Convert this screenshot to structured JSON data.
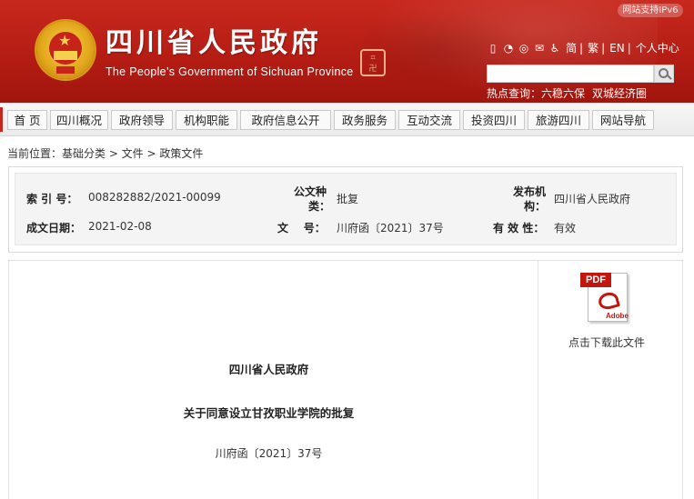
{
  "header": {
    "site_title": "四川省人民政府",
    "site_subtitle": "The People’s Government of Sichuan Province",
    "ipv6_badge": "网站支持IPv6",
    "languages": [
      "简",
      "繁",
      "EN",
      "个人中心"
    ],
    "search_placeholder": "",
    "hot_label": "热点查询：",
    "hot_items": [
      "六稳六保",
      "双城经济圈"
    ],
    "icons": [
      "mobile-icon",
      "weibo-icon",
      "wechat-icon",
      "message-icon",
      "accessibility-icon"
    ]
  },
  "nav": {
    "items": [
      "首 页",
      "四川概况",
      "政府领导",
      "机构职能",
      "政府信息公开",
      "政务服务",
      "互动交流",
      "投资四川",
      "旅游四川",
      "网站导航"
    ]
  },
  "breadcrumb": "当前位置：基础分类 > 文件 > 政策文件",
  "info": {
    "index_label": "索 引 号：",
    "index_value": "008282882/2021-00099",
    "category_label_1": "公文种",
    "category_label_2": "类：",
    "category_value": "批复",
    "issuer_label_1": "发布机",
    "issuer_label_2": "构：",
    "issuer_value": "四川省人民政府",
    "date_label": "成文日期：",
    "date_value": "2021-02-08",
    "docno_label": "文    号：",
    "docno_value": "川府函〔2021〕37号",
    "valid_label": "有 效 性：",
    "valid_value": "有效"
  },
  "download": {
    "pdf_tag": "PDF",
    "adobe": "Adobe",
    "label": "点击下载此文件"
  },
  "document": {
    "issuer": "四川省人民政府",
    "title": "关于同意设立甘孜职业学院的批复",
    "number": "川府函〔2021〕37号"
  },
  "colors": {
    "banner_red": "#b31c13",
    "accent_red": "#c3281f"
  }
}
